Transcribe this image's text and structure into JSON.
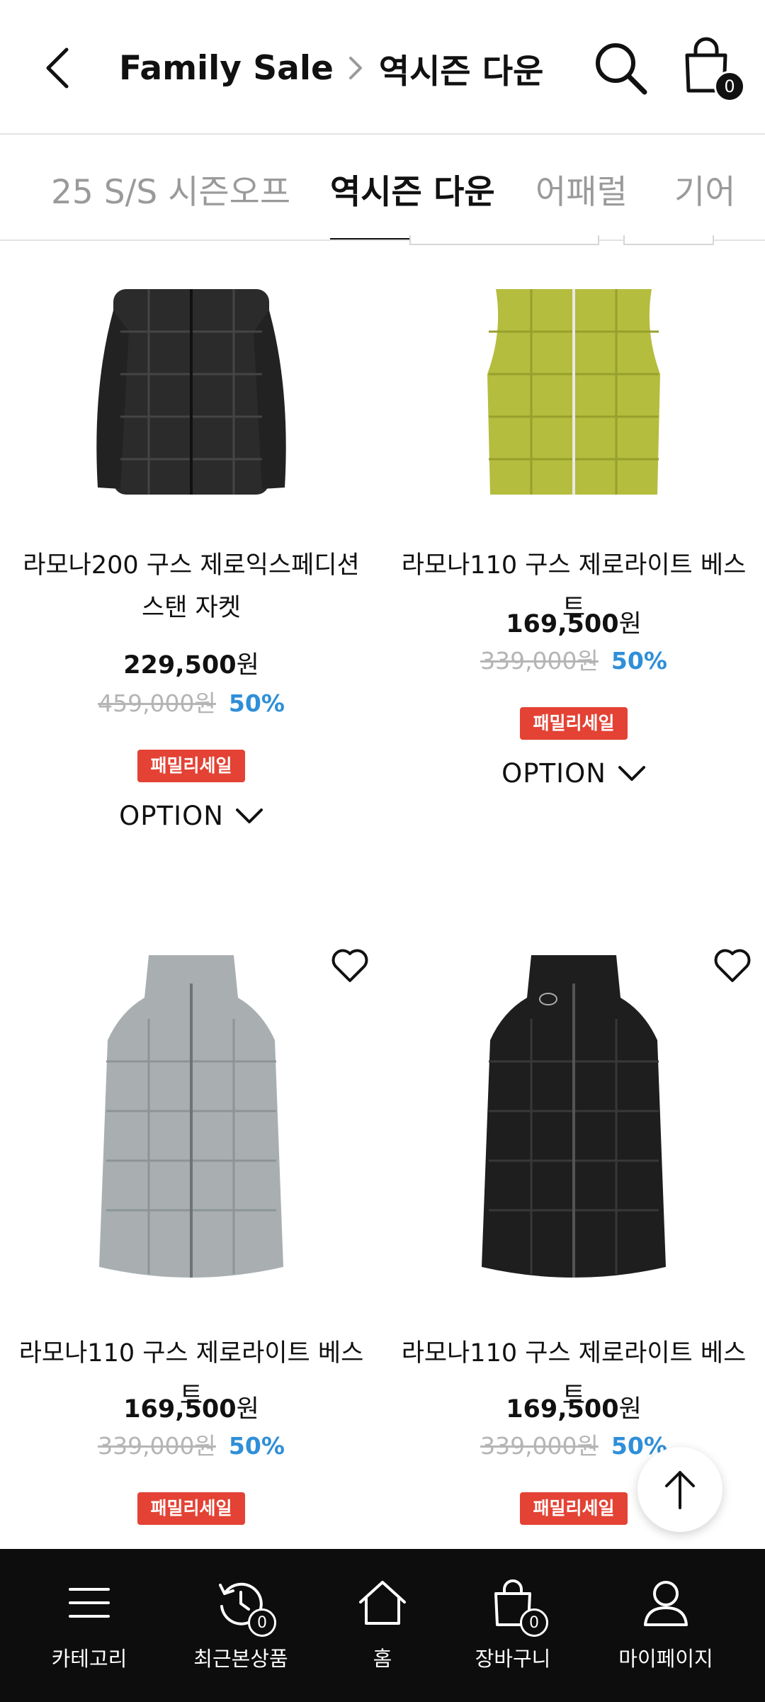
{
  "header": {
    "title": "Family Sale",
    "subtitle": "역시즌 다운",
    "cart_count": "0"
  },
  "tabs": [
    {
      "label": "25 S/S 시즌오프",
      "active": false
    },
    {
      "label": "역시즌 다운",
      "active": true
    },
    {
      "label": "어패럴",
      "active": false
    },
    {
      "label": "기어",
      "active": false
    }
  ],
  "products": [
    {
      "name": "라모나200 구스 제로익스페디션 스탠 자켓",
      "price": "229,500",
      "currency": "원",
      "original_price": "459,000",
      "discount": "50%",
      "badge": "패밀리세일",
      "option_label": "OPTION",
      "color": "#2b2b2b"
    },
    {
      "name": "라모나110 구스 제로라이트 베스트",
      "price": "169,500",
      "currency": "원",
      "original_price": "339,000",
      "discount": "50%",
      "badge": "패밀리세일",
      "option_label": "OPTION",
      "color": "#b4bd3e"
    },
    {
      "name": "라모나110 구스 제로라이트 베스트",
      "price": "169,500",
      "currency": "원",
      "original_price": "339,000",
      "discount": "50%",
      "badge": "패밀리세일",
      "color": "#a9afb1"
    },
    {
      "name": "라모나110 구스 제로라이트 베스트",
      "price": "169,500",
      "currency": "원",
      "original_price": "339,000",
      "discount": "50%",
      "badge": "패밀리세일",
      "color": "#1e1e1e"
    }
  ],
  "bottom_nav": [
    {
      "label": "카테고리",
      "icon": "menu-icon"
    },
    {
      "label": "최근본상품",
      "icon": "history-icon",
      "badge": "0"
    },
    {
      "label": "홈",
      "icon": "home-icon"
    },
    {
      "label": "장바구니",
      "icon": "cart-icon",
      "badge": "0"
    },
    {
      "label": "마이페이지",
      "icon": "user-icon"
    }
  ],
  "colors": {
    "discount": "#2f8fd8",
    "badge": "#e34234",
    "nav_bg": "#0d0d0d"
  }
}
